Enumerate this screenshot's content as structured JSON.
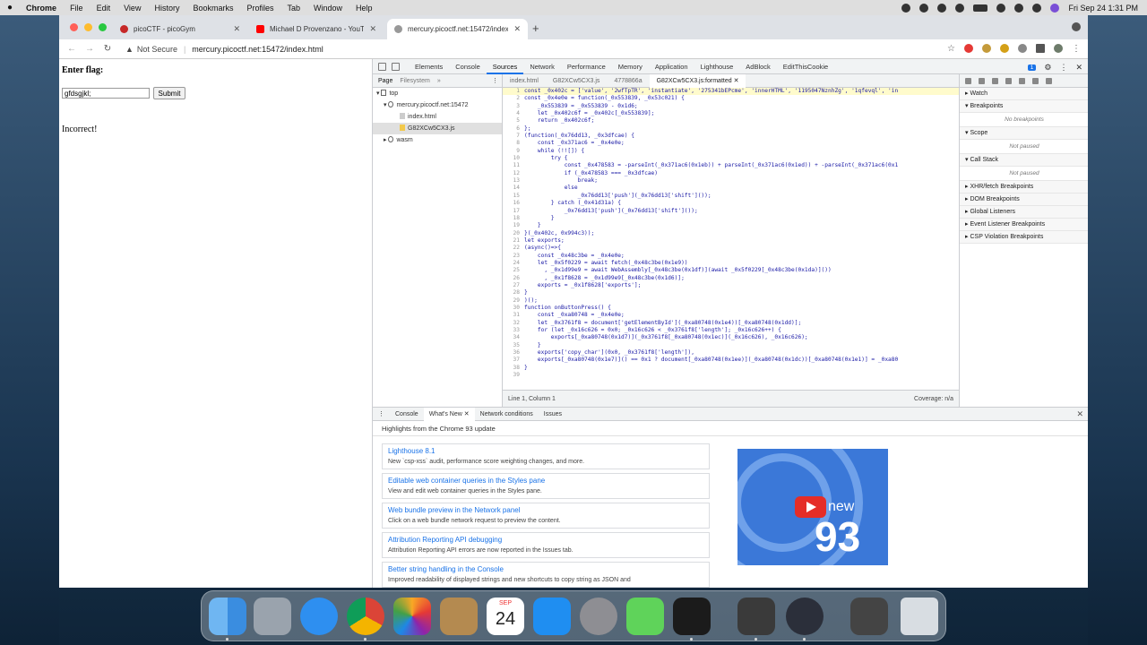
{
  "menubar": {
    "app": "Chrome",
    "items": [
      "File",
      "Edit",
      "View",
      "History",
      "Bookmarks",
      "Profiles",
      "Tab",
      "Window",
      "Help"
    ],
    "clock": "Fri Sep 24  1:31 PM"
  },
  "browser": {
    "tabs": [
      {
        "label": "picoCTF - picoGym",
        "color": "#c62828"
      },
      {
        "label": "Michael D Provenzano - YouTube",
        "color": "#ff0000"
      },
      {
        "label": "mercury.picoctf.net:15472/index",
        "color": "#888888"
      }
    ],
    "security": "Not Secure",
    "url": "mercury.picoctf.net:15472/index.html"
  },
  "page": {
    "label": "Enter flag:",
    "input_value": "gfdsgjkl;",
    "submit": "Submit",
    "result": "Incorrect!"
  },
  "devtools": {
    "tabs": [
      "Elements",
      "Console",
      "Sources",
      "Network",
      "Performance",
      "Memory",
      "Application",
      "Lighthouse",
      "AdBlock",
      "EditThisCookie"
    ],
    "active_tab": "Sources",
    "badge": "1",
    "navigator": {
      "tabs": [
        "Page",
        "Filesystem"
      ],
      "tree": [
        "top",
        "mercury.picoctf.net:15472",
        "index.html",
        "G82XCw5CX3.js",
        "wasm"
      ]
    },
    "editor": {
      "tabs": [
        "index.html",
        "G82XCw5CX3.js",
        "4778866a",
        "G82XCw5CX3.js:formatted"
      ],
      "lines": [
        "const _0x402c = ['value', '2wfTpTR', 'instantiate', '275341bEPcme', 'innerHTML', '1195047NznhZg', '1qfevql', 'in",
        "const _0x4e0e = function(_0x553839, _0x53c021) {",
        "    _0x553839 = _0x553839 - 0x1d6;",
        "    let _0x402c6f = _0x402c[_0x553839];",
        "    return _0x402c6f;",
        "};",
        "(function(_0x76dd13, _0x3dfcae) {",
        "    const _0x371ac6 = _0x4e0e;",
        "    while (!![]) {",
        "        try {",
        "            const _0x478583 = -parseInt(_0x371ac6(0x1eb)) + parseInt(_0x371ac6(0x1ed)) + -parseInt(_0x371ac6(0x1",
        "            if (_0x478583 === _0x3dfcae)",
        "                break;",
        "            else",
        "                _0x76dd13['push'](_0x76dd13['shift']());",
        "        } catch (_0x41d31a) {",
        "            _0x76dd13['push'](_0x76dd13['shift']());",
        "        }",
        "    }",
        "}(_0x402c, 0x994c3));",
        "let exports;",
        "(async()=>{",
        "    const _0x48c3be = _0x4e0e;",
        "    let _0x5f0229 = await fetch(_0x48c3be(0x1e9))",
        "      , _0x1d99e9 = await WebAssembly[_0x48c3be(0x1df)](await _0x5f0229[_0x48c3be(0x1da)]())",
        "      , _0x1f8628 = _0x1d99e9[_0x48c3be(0x1d6)];",
        "    exports = _0x1f8628['exports'];",
        "}",
        ")();",
        "function onButtonPress() {",
        "    const _0xa80748 = _0x4e0e;",
        "    let _0x3761f8 = document['getElementById'](_0xa80748(0x1e4))[_0xa80748(0x1dd)];",
        "    for (let _0x16c626 = 0x0; _0x16c626 < _0x3761f8['length']; _0x16c626++) {",
        "        exports[_0xa80748(0x1d7)](_0x3761f8[_0xa80748(0x1ec)](_0x16c626), _0x16c626);",
        "    }",
        "    exports['copy_char'](0x0, _0x3761f8['length']),",
        "    exports[_0xa80748(0x1e7)]() == 0x1 ? document[_0xa80748(0x1ee)](_0xa80748(0x1dc))[_0xa80748(0x1e1)] = _0xa80",
        "}",
        ""
      ],
      "position": "Line 1, Column 1",
      "coverage": "Coverage: n/a"
    },
    "debugger": {
      "sections": [
        {
          "title": "Watch",
          "body": ""
        },
        {
          "title": "Breakpoints",
          "body": "No breakpoints"
        },
        {
          "title": "Scope",
          "body": "Not paused"
        },
        {
          "title": "Call Stack",
          "body": "Not paused"
        },
        {
          "title": "XHR/fetch Breakpoints",
          "body": ""
        },
        {
          "title": "DOM Breakpoints",
          "body": ""
        },
        {
          "title": "Global Listeners",
          "body": ""
        },
        {
          "title": "Event Listener Breakpoints",
          "body": ""
        },
        {
          "title": "CSP Violation Breakpoints",
          "body": ""
        }
      ]
    },
    "drawer": {
      "tabs": [
        "Console",
        "What's New",
        "Network conditions",
        "Issues"
      ],
      "headline": "Highlights from the Chrome 93 update",
      "items": [
        {
          "title": "Lighthouse 8.1",
          "desc": "New `csp-xss` audit, performance score weighting changes, and more."
        },
        {
          "title": "Editable web container queries in the Styles pane",
          "desc": "View and edit web container queries in the Styles pane."
        },
        {
          "title": "Web bundle preview in the Network panel",
          "desc": "Click on a web bundle network request to preview the content."
        },
        {
          "title": "Attribution Reporting API debugging",
          "desc": "Attribution Reporting API errors are now reported in the Issues tab."
        },
        {
          "title": "Better string handling in the Console",
          "desc": "Improved readability of displayed strings and new shortcuts to copy string as JSON and"
        }
      ],
      "promo_new": "new",
      "promo_version": "93"
    }
  },
  "dock": {
    "calendar_month": "SEP",
    "calendar_day": "24",
    "apps": [
      "finder-icon",
      "launchpad-icon",
      "safari-icon",
      "chrome-icon",
      "photos-icon",
      "contacts-icon",
      "calendar-icon",
      "app-store-icon",
      "system-preferences-icon",
      "messages-icon",
      "terminal-icon",
      "sublime-text-icon",
      "obs-icon",
      "screenshot-icon",
      "trash-icon"
    ]
  }
}
